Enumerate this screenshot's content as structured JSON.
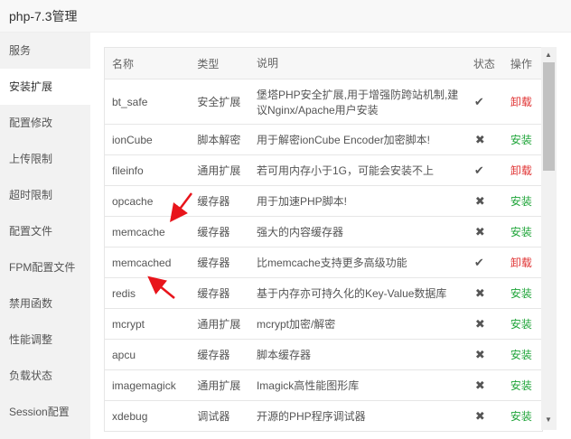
{
  "window": {
    "title": "php-7.3管理"
  },
  "sidebar": {
    "items": [
      {
        "label": "服务"
      },
      {
        "label": "安装扩展",
        "active": true
      },
      {
        "label": "配置修改"
      },
      {
        "label": "上传限制"
      },
      {
        "label": "超时限制"
      },
      {
        "label": "配置文件"
      },
      {
        "label": "FPM配置文件"
      },
      {
        "label": "禁用函数"
      },
      {
        "label": "性能调整"
      },
      {
        "label": "负载状态"
      },
      {
        "label": "Session配置"
      }
    ]
  },
  "table": {
    "headers": {
      "name": "名称",
      "type": "类型",
      "desc": "说明",
      "status": "状态",
      "action": "操作"
    },
    "rows": [
      {
        "name": "bt_safe",
        "type": "安全扩展",
        "desc": "堡塔PHP安全扩展,用于增强防跨站机制,建议Nginx/Apache用户安装",
        "installed": true,
        "status_icon": "check-icon",
        "action": "卸载"
      },
      {
        "name": "ionCube",
        "type": "脚本解密",
        "desc": "用于解密ionCube Encoder加密脚本!",
        "installed": false,
        "status_icon": "cross-icon",
        "action": "安装"
      },
      {
        "name": "fileinfo",
        "type": "通用扩展",
        "desc": "若可用内存小于1G，可能会安装不上",
        "installed": true,
        "status_icon": "check-icon",
        "action": "卸载"
      },
      {
        "name": "opcache",
        "type": "缓存器",
        "desc": "用于加速PHP脚本!",
        "installed": false,
        "status_icon": "cross-icon",
        "action": "安装"
      },
      {
        "name": "memcache",
        "type": "缓存器",
        "desc": "强大的内容缓存器",
        "installed": false,
        "status_icon": "cross-icon",
        "action": "安装"
      },
      {
        "name": "memcached",
        "type": "缓存器",
        "desc": "比memcache支持更多高级功能",
        "installed": true,
        "status_icon": "check-icon",
        "action": "卸载"
      },
      {
        "name": "redis",
        "type": "缓存器",
        "desc": "基于内存亦可持久化的Key-Value数据库",
        "installed": false,
        "status_icon": "cross-icon",
        "action": "安装"
      },
      {
        "name": "mcrypt",
        "type": "通用扩展",
        "desc": "mcrypt加密/解密",
        "installed": false,
        "status_icon": "cross-icon",
        "action": "安装"
      },
      {
        "name": "apcu",
        "type": "缓存器",
        "desc": "脚本缓存器",
        "installed": false,
        "status_icon": "cross-icon",
        "action": "安装"
      },
      {
        "name": "imagemagick",
        "type": "通用扩展",
        "desc": "Imagick高性能图形库",
        "installed": false,
        "status_icon": "cross-icon",
        "action": "安装"
      },
      {
        "name": "xdebug",
        "type": "调试器",
        "desc": "开源的PHP程序调试器",
        "installed": false,
        "status_icon": "cross-icon",
        "action": "安装"
      }
    ]
  },
  "colors": {
    "install": "#20a53a",
    "uninstall": "#e03434",
    "annotation_arrow": "#e8141b"
  }
}
